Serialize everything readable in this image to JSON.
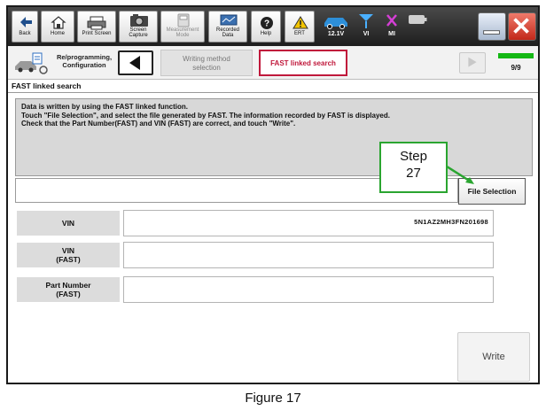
{
  "toolbar": {
    "back": "Back",
    "home": "Home",
    "print_screen": "Print Screen",
    "screen_capture": [
      "Screen",
      "Capture"
    ],
    "measurement_mode": [
      "Measurement",
      "Mode"
    ],
    "recorded_data": [
      "Recorded",
      "Data"
    ],
    "help": "Help",
    "ert": "ERT",
    "battery_voltage": "12.1V",
    "vi_label": "VI",
    "mi_label": "MI"
  },
  "nav": {
    "section_label": [
      "Re/programming,",
      "Configuration"
    ],
    "crumbs": [
      {
        "label": [
          "Writing method",
          "selection"
        ],
        "state": "inactive"
      },
      {
        "label": [
          "FAST linked search"
        ],
        "state": "active"
      }
    ],
    "progress": 1.0,
    "page_count": "9/9"
  },
  "page_title": "FAST linked search",
  "instructions": [
    "Data is written by using the FAST linked function.",
    "Touch \"File Selection\", and select the file generated by FAST. The information recorded by FAST is displayed.",
    "Check that the Part Number(FAST) and VIN (FAST) are correct, and touch \"Write\"."
  ],
  "file_selection": {
    "value": "",
    "button": "File Selection"
  },
  "fields": [
    {
      "label": [
        "VIN"
      ],
      "value": "5N1AZ2MH3FN201698"
    },
    {
      "label": [
        "VIN",
        "(FAST)"
      ],
      "value": ""
    },
    {
      "label": [
        "Part Number",
        "(FAST)"
      ],
      "value": ""
    }
  ],
  "write_button": "Write",
  "callout": {
    "line1": "Step",
    "line2": "27"
  },
  "caption": "Figure 17",
  "colors": {
    "active_crumb": "#c0183b",
    "callout_border": "#2aa530",
    "progress": "#14b814"
  }
}
